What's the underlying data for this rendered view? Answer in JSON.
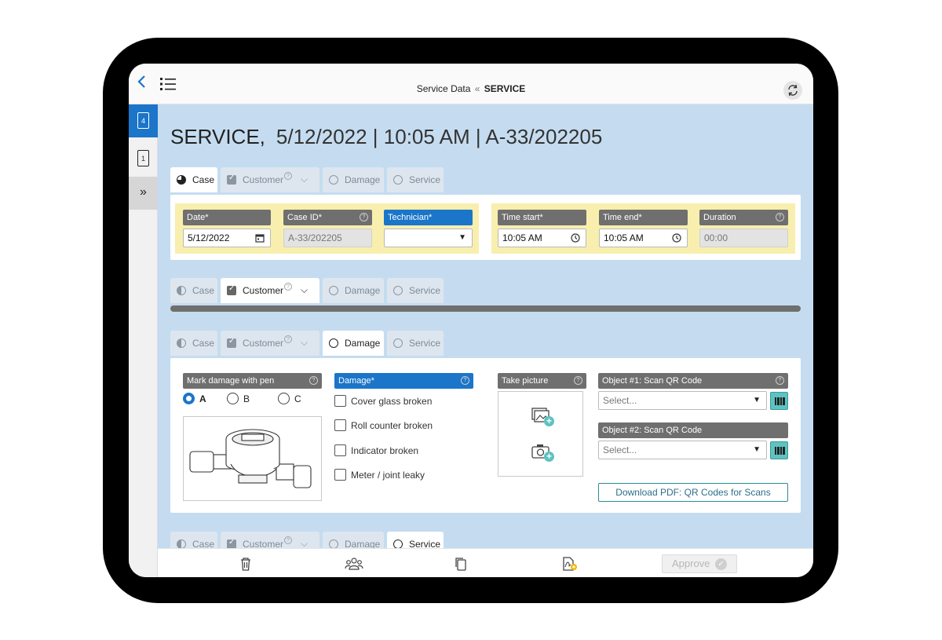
{
  "topbar": {
    "title_prefix": "Service Data",
    "title_separator": "«",
    "title_bold": "SERVICE"
  },
  "sidebar": {
    "items": [
      {
        "badge": "4",
        "icon": "document-icon",
        "active": true
      },
      {
        "badge": "1",
        "icon": "document-icon",
        "active": false
      },
      {
        "icon": "double-chevron-right-icon",
        "symbol": "»"
      }
    ]
  },
  "heading": {
    "main": "SERVICE,",
    "rest": "5/12/2022 | 10:05 AM | A-33/202205"
  },
  "tabs": {
    "case": "Case",
    "customer": "Customer",
    "damage": "Damage",
    "service": "Service",
    "help": "?"
  },
  "case_section": {
    "date": {
      "label": "Date*",
      "value": "5/12/2022"
    },
    "case_id": {
      "label": "Case ID*",
      "value": "A-33/202205"
    },
    "technician": {
      "label": "Technician*",
      "value": ""
    },
    "time_start": {
      "label": "Time start*",
      "value": "10:05 AM"
    },
    "time_end": {
      "label": "Time end*",
      "value": "10:05 AM"
    },
    "duration": {
      "label": "Duration",
      "value": "00:00"
    }
  },
  "damage_section": {
    "mark_label": "Mark damage with pen",
    "radios": [
      {
        "label": "A",
        "selected": true
      },
      {
        "label": "B",
        "selected": false
      },
      {
        "label": "C",
        "selected": false
      }
    ],
    "damage_label": "Damage*",
    "checks": [
      {
        "label": "Cover glass broken",
        "checked": false
      },
      {
        "label": "Roll counter broken",
        "checked": false
      },
      {
        "label": "Indicator broken",
        "checked": false
      },
      {
        "label": "Meter / joint leaky",
        "checked": false
      }
    ],
    "picture_label": "Take picture",
    "object1": {
      "label": "Object #1: Scan QR Code",
      "placeholder": "Select..."
    },
    "object2": {
      "label": "Object #2: Scan QR Code",
      "placeholder": "Select..."
    },
    "pdf_button": "Download PDF: QR Codes for Scans"
  },
  "toolbar": {
    "approve": "Approve"
  },
  "colors": {
    "accent": "#1b75c9",
    "content_bg": "#c5dcf0",
    "field_group_bg": "#f8efae",
    "field_label_bg": "#6f6f6f",
    "teal": "#5ec2c2"
  }
}
